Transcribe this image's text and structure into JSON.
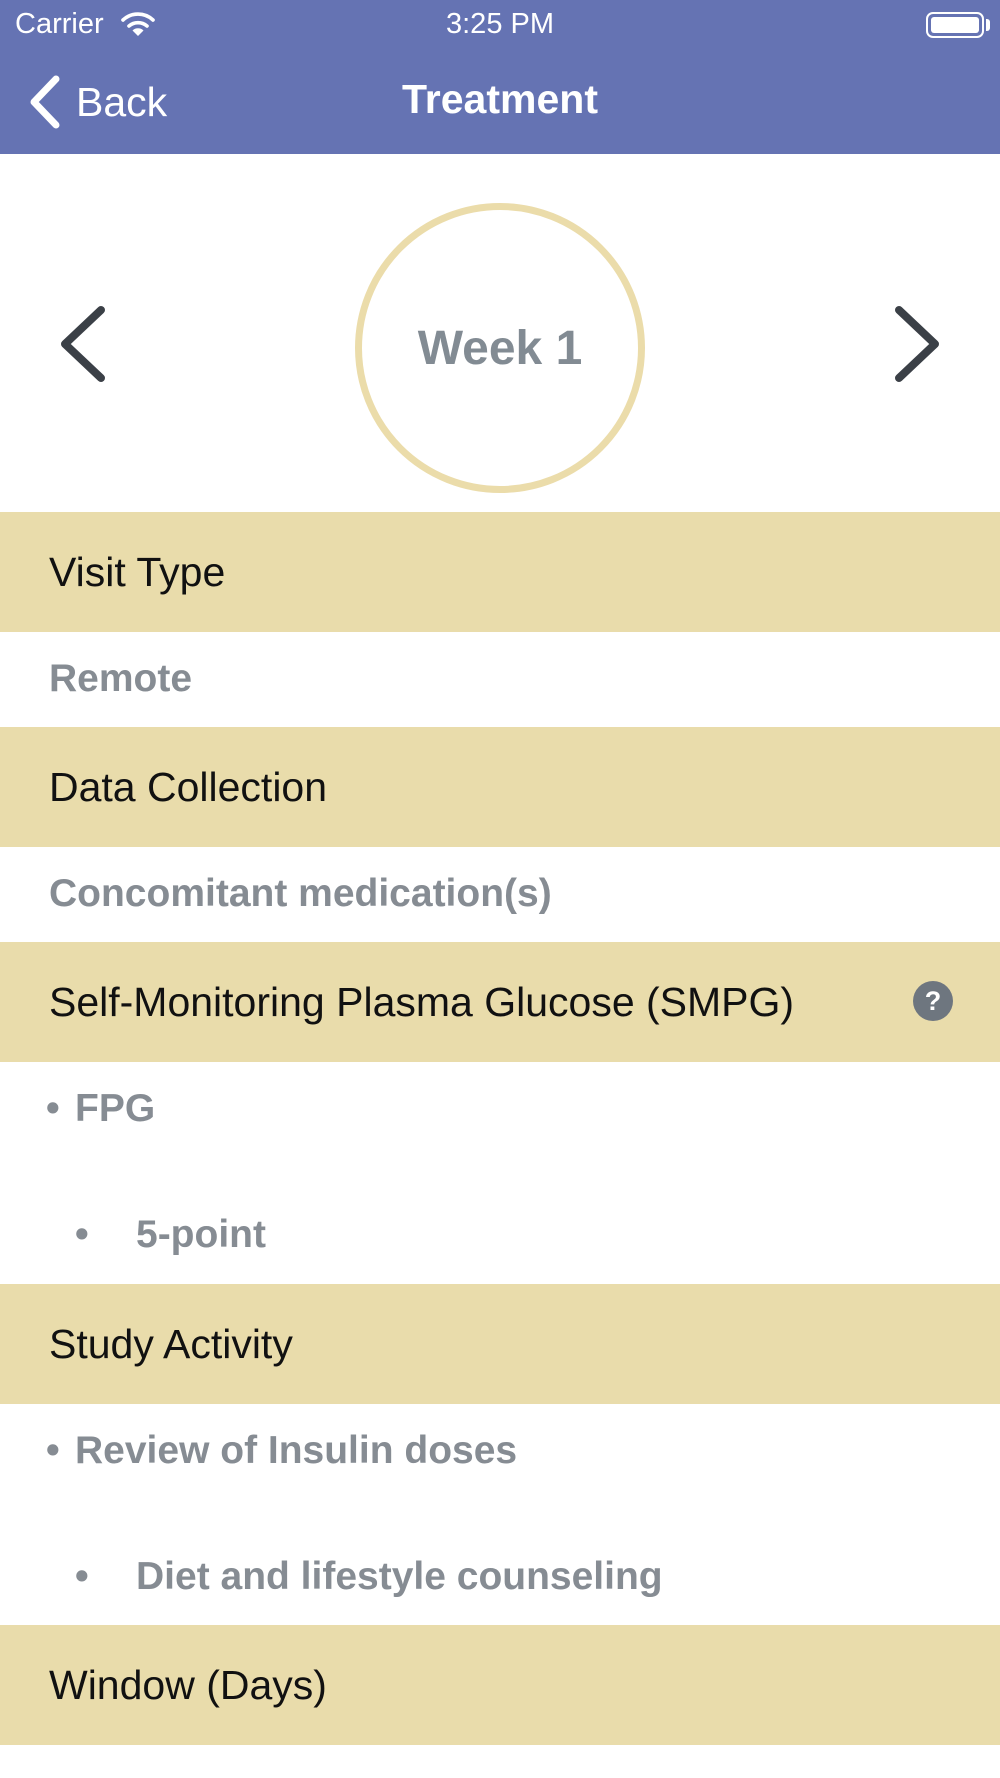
{
  "status_bar": {
    "carrier": "Carrier",
    "time": "3:25 PM"
  },
  "nav": {
    "back_label": "Back",
    "title": "Treatment"
  },
  "week_selector": {
    "label": "Week 1",
    "circle_color": "#ebdcaa"
  },
  "colors": {
    "nav_bar": "#6573b3",
    "section_header": "#e9dcab",
    "value_text": "#868c93"
  },
  "sections": {
    "visit_type": {
      "title": "Visit Type",
      "value": "Remote"
    },
    "data_collection": {
      "title": "Data Collection",
      "value": "Concomitant medication(s)"
    },
    "smpg": {
      "title": "Self-Monitoring Plasma Glucose (SMPG)",
      "help_icon": "?",
      "items": [
        "FPG",
        "5-point"
      ]
    },
    "study_activity": {
      "title": "Study Activity",
      "items": [
        "Review of Insulin doses",
        "Diet and lifestyle counseling"
      ]
    },
    "window": {
      "title": "Window (Days)"
    }
  },
  "bullet_char": "•"
}
